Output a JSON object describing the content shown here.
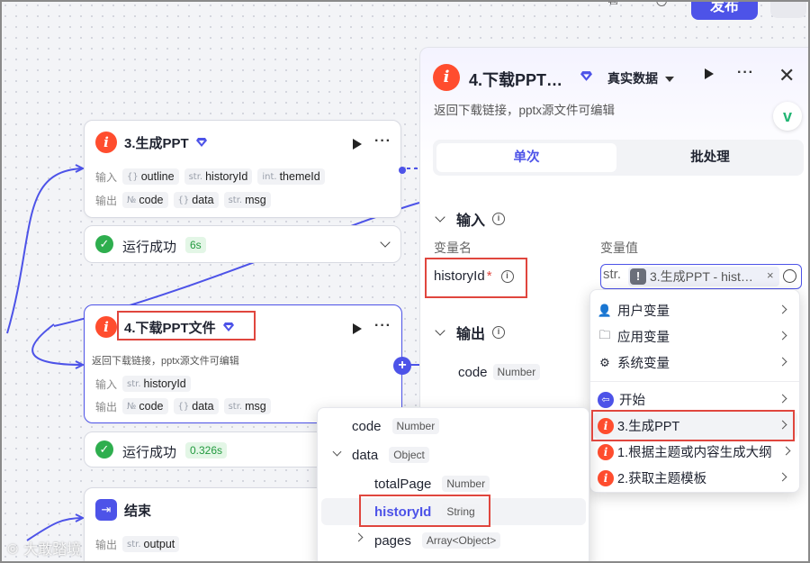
{
  "toolbar": {
    "publish_label": "发布"
  },
  "colors": {
    "accent": "#4d53e8",
    "success": "#2eae4e",
    "highlight": "#e0463e",
    "brand_logo": "#ff4d2e"
  },
  "nodes": {
    "gen_ppt": {
      "title": "3.生成PPT",
      "input_label": "输入",
      "output_label": "输出",
      "inputs": [
        {
          "type": "{}",
          "name": "outline"
        },
        {
          "type": "str.",
          "name": "historyId"
        },
        {
          "type": "int.",
          "name": "themeId"
        }
      ],
      "outputs": [
        {
          "type": "№",
          "name": "code"
        },
        {
          "type": "{}",
          "name": "data"
        },
        {
          "type": "str.",
          "name": "msg"
        }
      ],
      "status": "运行成功",
      "time": "6s"
    },
    "download_ppt": {
      "title": "4.下载PPT文件",
      "desc": "返回下载链接，pptx源文件可编辑",
      "input_label": "输入",
      "output_label": "输出",
      "inputs": [
        {
          "type": "str.",
          "name": "historyId"
        }
      ],
      "outputs": [
        {
          "type": "№",
          "name": "code"
        },
        {
          "type": "{}",
          "name": "data"
        },
        {
          "type": "str.",
          "name": "msg"
        }
      ],
      "status": "运行成功",
      "time": "0.326s"
    },
    "end": {
      "title": "结束",
      "output_label": "输出",
      "outputs": [
        {
          "type": "str.",
          "name": "output"
        }
      ]
    }
  },
  "panel": {
    "title": "4.下载PPT…",
    "data_mode": "真实数据",
    "desc": "返回下载链接，pptx源文件可编辑",
    "badge": "v",
    "tabs": [
      "单次",
      "批处理"
    ],
    "input_section": "输入",
    "col_name": "变量名",
    "col_value": "变量值",
    "var_name": "historyId",
    "required_mark": "*",
    "val_type": "str.",
    "val_ref": "3.生成PPT - hist…",
    "val_remove": "×",
    "output_section": "输出",
    "outputs": [
      {
        "name": "code",
        "type": "Number"
      }
    ]
  },
  "var_menu": {
    "items": [
      {
        "icon": "user-icon",
        "label": "用户变量"
      },
      {
        "icon": "folder-icon",
        "label": "应用变量"
      },
      {
        "icon": "gear-icon",
        "label": "系统变量"
      },
      {
        "icon": "start-icon",
        "label": "开始"
      },
      {
        "icon": "logo-icon",
        "label": "3.生成PPT"
      },
      {
        "icon": "logo-icon",
        "label": "1.根据主题或内容生成大纲"
      },
      {
        "icon": "logo-icon",
        "label": "2.获取主题模板"
      }
    ]
  },
  "field_menu": {
    "rows": [
      {
        "name": "code",
        "type": "Number"
      },
      {
        "name": "data",
        "type": "Object"
      },
      {
        "name": "totalPage",
        "type": "Number"
      },
      {
        "name": "historyId",
        "type": "String"
      },
      {
        "name": "pages",
        "type": "Array<Object>"
      }
    ]
  },
  "watermark": "大敢踏境"
}
